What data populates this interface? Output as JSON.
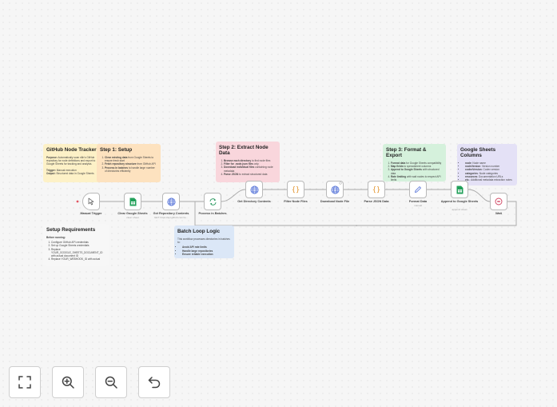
{
  "notes": {
    "tracker": {
      "title": "GitHub Node Tracker",
      "purpose_label": "Purpose:",
      "purpose_text": "Automatically scan n8n's GitHub repository for node definitions and export to Google Sheets for tracking and analysis.",
      "trigger_label": "Trigger:",
      "trigger_text": "Manual execution",
      "output_label": "Output:",
      "output_text": "Structured data in Google Sheets"
    },
    "step1": {
      "title": "Step 1: Setup",
      "items": [
        {
          "b": "Clear existing data",
          "t": " from Google Sheets to ensure fresh start"
        },
        {
          "b": "Fetch repository structure",
          "t": " from GitHub API"
        },
        {
          "b": "Process in batches",
          "t": " to handle large number of directories efficiently"
        }
      ]
    },
    "step2": {
      "title": "Step 2: Extract Node Data",
      "items": [
        {
          "b": "Browse each directory",
          "t": " to find node files"
        },
        {
          "b": "Filter for .node.json files",
          "t": " only"
        },
        {
          "b": "Download individual files",
          "t": " containing node metadata"
        },
        {
          "b": "Parse JSON",
          "t": " to extract structured data"
        }
      ]
    },
    "step3": {
      "title": "Step 3: Format & Export",
      "items": [
        {
          "b": "Format data",
          "t": " for Google Sheets compatibility"
        },
        {
          "b": "Map fields",
          "t": " to spreadsheet columns"
        },
        {
          "b": "Append to Google Sheets",
          "t": " with structured data"
        },
        {
          "b": "Rate limiting",
          "t": " with wait nodes to respect API limits"
        }
      ]
    },
    "columns": {
      "title": "Google Sheets Columns",
      "items": [
        {
          "b": "node",
          "t": ": Node name"
        },
        {
          "b": "nodeVersion",
          "t": ": Version number"
        },
        {
          "b": "codexVersion",
          "t": ": Codex version"
        },
        {
          "b": "categories",
          "t": ": Node categories"
        },
        {
          "b": "resources",
          "t": ": Documentation URLs"
        },
        {
          "b": "etc.",
          "t": ": Additional metadata extraction notes"
        }
      ]
    },
    "setup": {
      "title": "Setup Requirements",
      "before": "Before running:",
      "items": [
        "Configure GitHub API credentials",
        "Set up Google Sheets credentials",
        "Replace YOUR_GOOGLE_SHEETS_DOCUMENT_ID with actual document ID",
        "Replace YOUR_WEBHOOK_ID with actual"
      ]
    },
    "batch": {
      "title": "Batch Loop Logic",
      "intro": "This workflow processes directories in batches to:",
      "items": [
        "Avoid API rate limits",
        "Handle large repositories",
        "Ensure reliable execution"
      ]
    }
  },
  "nodes": [
    {
      "label": "Manual Trigger",
      "sub": "",
      "icon": "pointer-icon"
    },
    {
      "label": "Clear Google Sheets",
      "sub": "clear: sheet",
      "icon": "google-sheets-icon"
    },
    {
      "label": "Get Repository Contents",
      "sub": "GET: https://api.github.com/re...",
      "icon": "globe-icon"
    },
    {
      "label": "Process in Batches",
      "sub": "",
      "icon": "loop-icon"
    },
    {
      "label": "Get Directory Contents",
      "sub": "",
      "icon": "globe-icon"
    },
    {
      "label": "Filter Node Files",
      "sub": "",
      "icon": "code-icon"
    },
    {
      "label": "Download Node File",
      "sub": "",
      "icon": "globe-icon"
    },
    {
      "label": "Parse JSON Data",
      "sub": "",
      "icon": "code-icon"
    },
    {
      "label": "Format Data",
      "sub": "manual",
      "icon": "pen-icon"
    },
    {
      "label": "Append to Google Sheets",
      "sub": "append: sheet",
      "icon": "google-sheets-icon"
    },
    {
      "label": "Wait",
      "sub": "",
      "icon": "wait-icon"
    }
  ],
  "colors": {
    "sheets_green": "#22a05a",
    "globe_blue": "#4b6bd6",
    "code_orange": "#e2932b",
    "loop_green": "#2e9b64",
    "wait_red": "#d04460",
    "trigger_red": "#e25561"
  },
  "controls": [
    "fit-view-button",
    "zoom-in-button",
    "zoom-out-button",
    "undo-button"
  ]
}
